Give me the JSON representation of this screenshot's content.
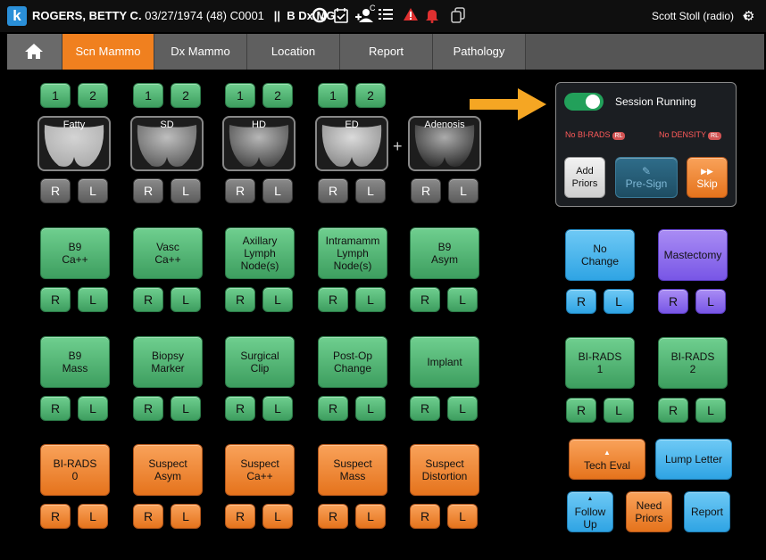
{
  "topbar": {
    "patient_name": "ROGERS, BETTY C.",
    "patient_info": "03/27/1974 (48) C0001",
    "separator": "||",
    "exam": "B Dx MG",
    "user": "Scott Stoll (radio)",
    "icons": [
      "q-icon",
      "calendar-check-icon",
      "add-user-icon",
      "list-icon",
      "alert-triangle-icon",
      "bell-icon",
      "copy-icon",
      "gear-icon"
    ],
    "add_user_badge": "C"
  },
  "tabs": [
    {
      "label": "Scn Mammo",
      "active": true
    },
    {
      "label": "Dx Mammo"
    },
    {
      "label": "Location"
    },
    {
      "label": "Report"
    },
    {
      "label": "Pathology"
    }
  ],
  "density": {
    "number_buttons": [
      "1",
      "2"
    ],
    "side_buttons": [
      "R",
      "L"
    ],
    "plus": "+",
    "items": [
      {
        "label": "Fatty"
      },
      {
        "label": "SD"
      },
      {
        "label": "HD"
      },
      {
        "label": "ED"
      },
      {
        "label": "Adenosis"
      }
    ]
  },
  "findings": {
    "row1": [
      "B9\nCa++",
      "Vasc\nCa++",
      "Axillary\nLymph\nNode(s)",
      "Intramamm\nLymph\nNode(s)",
      "B9\nAsym"
    ],
    "row2": [
      "B9\nMass",
      "Biopsy\nMarker",
      "Surgical\nClip",
      "Post-Op\nChange",
      "Implant"
    ],
    "row3": [
      "BI-RADS\n0",
      "Suspect\nAsym",
      "Suspect\nCa++",
      "Suspect\nMass",
      "Suspect\nDistortion"
    ]
  },
  "session": {
    "title": "Session Running",
    "no_birads": "No BI-RADS",
    "no_density": "No DENSITY",
    "pill": "RL",
    "add_priors": "Add\nPriors",
    "presign": "Pre-Sign",
    "skip": "Skip"
  },
  "right": {
    "no_change": "No\nChange",
    "mastectomy": "Mastectomy",
    "birads1": "BI-RADS\n1",
    "birads2": "BI-RADS\n2",
    "tech_eval": "Tech Eval",
    "lump_letter": "Lump Letter",
    "follow_up": "Follow\nUp",
    "need_priors": "Need\nPriors",
    "report": "Report"
  }
}
